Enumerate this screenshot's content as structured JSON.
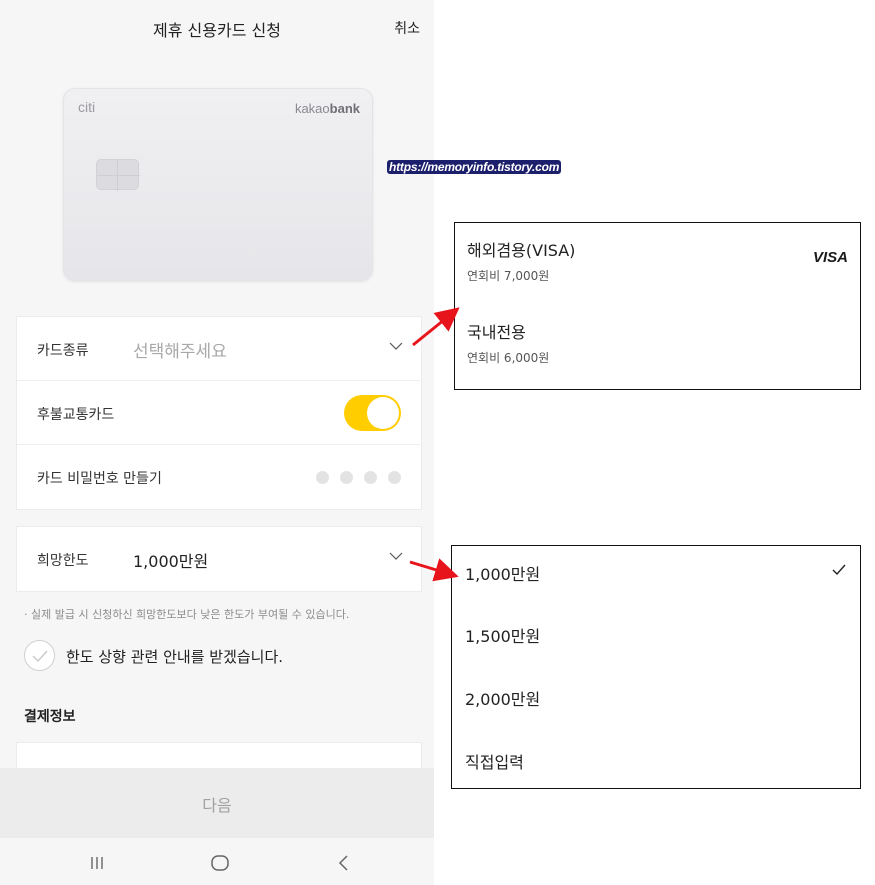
{
  "header": {
    "title": "제휴 신용카드 신청",
    "cancel": "취소"
  },
  "card": {
    "issuer_logo": "citi",
    "brand_prefix": "kakao",
    "brand_suffix": "bank"
  },
  "form": {
    "card_type": {
      "label": "카드종류",
      "placeholder": "선택해주세요"
    },
    "transit": {
      "label": "후불교통카드",
      "enabled": true
    },
    "pin": {
      "label": "카드 비밀번호 만들기"
    },
    "limit": {
      "label": "희망한도",
      "value": "1,000만원"
    }
  },
  "notice": "· 실제 발급 시 신청하신 희망한도보다 낮은 한도가 부여될 수 있습니다.",
  "limit_notice_check": "한도 상향 관련 안내를 받겠습니다.",
  "payment_section": "결제정보",
  "next_button": "다음",
  "watermark": "https://memoryinfo.tistory.com",
  "card_type_options": [
    {
      "name": "해외겸용(VISA)",
      "fee": "연회비 7,000원",
      "badge": "VISA"
    },
    {
      "name": "국내전용",
      "fee": "연회비 6,000원"
    }
  ],
  "limit_options": [
    {
      "label": "1,000만원",
      "selected": true
    },
    {
      "label": "1,500만원"
    },
    {
      "label": "2,000만원"
    },
    {
      "label": "직접입력"
    }
  ],
  "colors": {
    "accent": "#ffcd00",
    "arrow": "#e8141c"
  }
}
